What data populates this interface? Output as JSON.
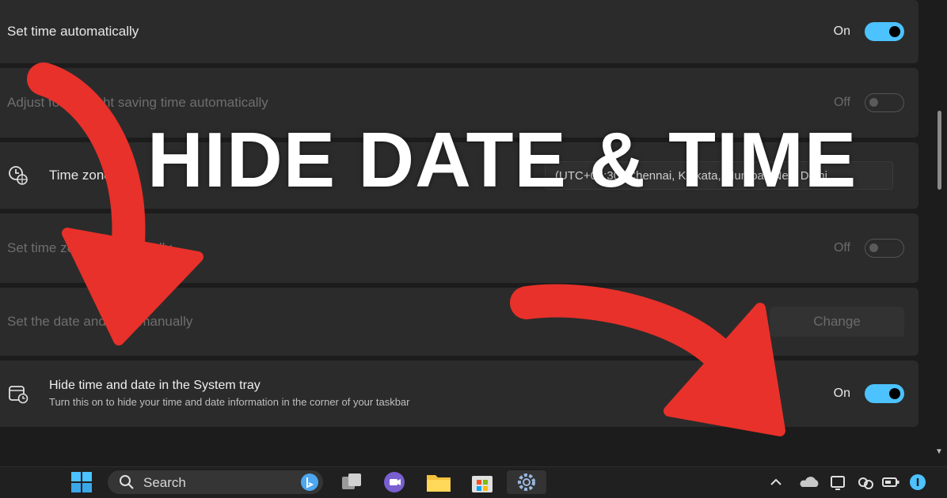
{
  "settings": {
    "set_time_auto": {
      "label": "Set time automatically",
      "state": "On"
    },
    "dst": {
      "label": "Adjust for daylight saving time automatically",
      "state": "Off"
    },
    "timezone": {
      "label": "Time zone",
      "value": "(UTC+05:30) Chennai, Kolkata, Mumbai, New Delhi"
    },
    "set_tz_auto": {
      "label": "Set time zone automatically",
      "state": "Off"
    },
    "manual": {
      "label": "Set the date and time manually",
      "button": "Change"
    },
    "hide_tray": {
      "label": "Hide time and date in the System tray",
      "description": "Turn this on to hide your time and date information in the corner of your taskbar",
      "state": "On"
    }
  },
  "overlay": {
    "headline": "HIDE DATE & TIME",
    "arrow_color": "#e8312a"
  },
  "taskbar": {
    "search_placeholder": "Search"
  },
  "colors": {
    "toggle_on": "#4cc2ff",
    "row_bg": "#2b2b2b",
    "page_bg": "#1c1c1c"
  }
}
